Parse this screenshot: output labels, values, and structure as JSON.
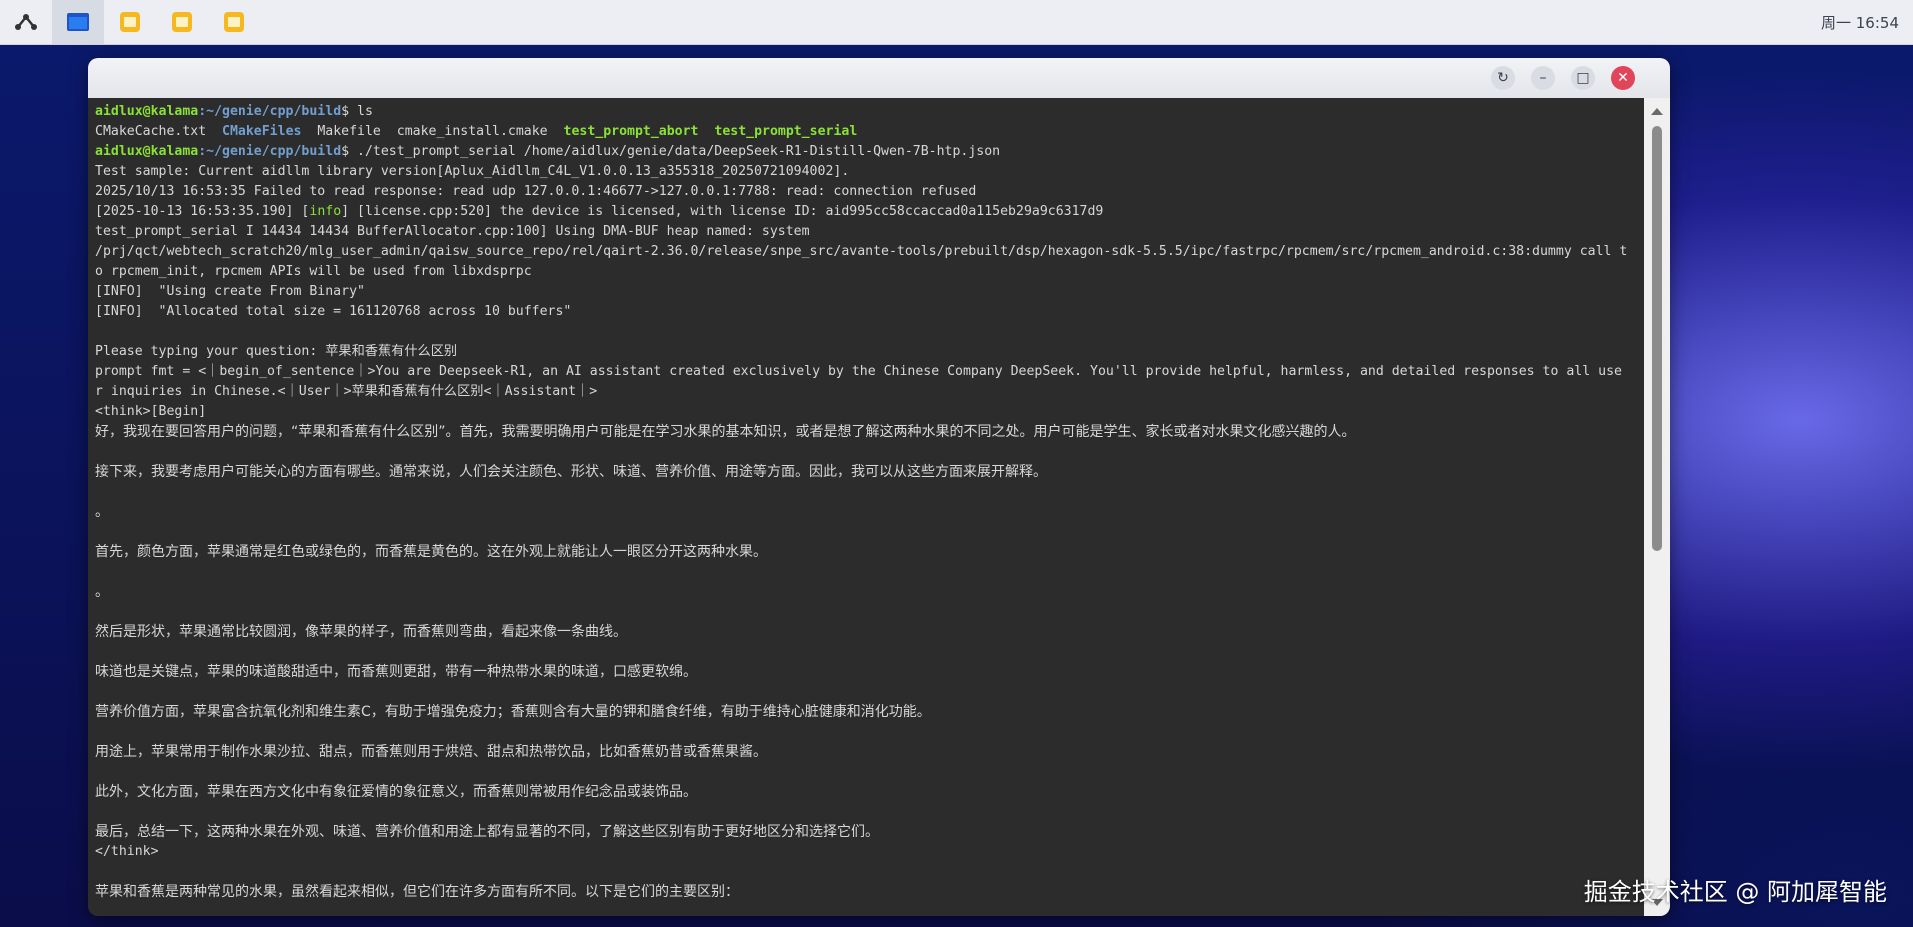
{
  "taskbar": {
    "clock": "周一 16:54",
    "icons": [
      "launcher-icon",
      "terminal-app-icon",
      "folder-icon",
      "folder-icon",
      "folder-icon"
    ]
  },
  "window": {
    "controls": [
      "refresh-icon",
      "minimize-icon",
      "maximize-icon",
      "close-icon"
    ]
  },
  "terminal": {
    "prompt_user": "aidlux@kalama",
    "prompt_path": ":~/genie/cpp/build",
    "lines": [
      {
        "kind": "prompt",
        "cmd": "$ ls"
      },
      {
        "kind": "ls",
        "items": [
          {
            "text": "CMakeCache.txt",
            "cls": "plain"
          },
          {
            "text": "CMakeFiles",
            "cls": "dir"
          },
          {
            "text": "Makefile",
            "cls": "plain"
          },
          {
            "text": "cmake_install.cmake",
            "cls": "plain"
          },
          {
            "text": "test_prompt_abort",
            "cls": "exec"
          },
          {
            "text": "test_prompt_serial",
            "cls": "exec"
          }
        ]
      },
      {
        "kind": "prompt",
        "cmd": "$ ./test_prompt_serial /home/aidlux/genie/data/DeepSeek-R1-Distill-Qwen-7B-htp.json"
      },
      {
        "kind": "text",
        "text": "Test sample: Current aidllm library version[Aplux_Aidllm_C4L_V1.0.0.13_a355318_20250721094002]."
      },
      {
        "kind": "text",
        "text": "2025/10/13 16:53:35 Failed to read response: read udp 127.0.0.1:46677->127.0.0.1:7788: read: connection refused"
      },
      {
        "kind": "info",
        "pre": "[2025-10-13 16:53:35.190] [",
        "tag": "info",
        "post": "] [license.cpp:520] the device is licensed, with license ID: aid995cc58ccaccad0a115eb29a9c6317d9"
      },
      {
        "kind": "text",
        "text": "test_prompt_serial I 14434 14434 BufferAllocator.cpp:100] Using DMA-BUF heap named: system"
      },
      {
        "kind": "text",
        "text": "/prj/qct/webtech_scratch20/mlg_user_admin/qaisw_source_repo/rel/qairt-2.36.0/release/snpe_src/avante-tools/prebuilt/dsp/hexagon-sdk-5.5.5/ipc/fastrpc/rpcmem/src/rpcmem_android.c:38:dummy call t"
      },
      {
        "kind": "text",
        "text": "o rpcmem_init, rpcmem APIs will be used from libxdsprpc"
      },
      {
        "kind": "text",
        "text": "[INFO]  \"Using create From Binary\""
      },
      {
        "kind": "text",
        "text": "[INFO]  \"Allocated total size = 161120768 across 10 buffers\""
      },
      {
        "kind": "text",
        "text": ""
      },
      {
        "kind": "text",
        "text": "Please typing your question: 苹果和香蕉有什么区别"
      },
      {
        "kind": "text",
        "text": "prompt fmt = <｜begin_of_sentence｜>You are Deepseek-R1, an AI assistant created exclusively by the Chinese Company DeepSeek. You'll provide helpful, harmless, and detailed responses to all use"
      },
      {
        "kind": "text",
        "text": "r inquiries in Chinese.<｜User｜>苹果和香蕉有什么区别<｜Assistant｜>"
      },
      {
        "kind": "text",
        "text": "<think>[Begin]"
      },
      {
        "kind": "zh",
        "text": "好，我现在要回答用户的问题，“苹果和香蕉有什么区别”。首先，我需要明确用户可能是在学习水果的基本知识，或者是想了解这两种水果的不同之处。用户可能是学生、家长或者对水果文化感兴趣的人。"
      },
      {
        "kind": "zh",
        "text": ""
      },
      {
        "kind": "zh",
        "text": "接下来，我要考虑用户可能关心的方面有哪些。通常来说，人们会关注颜色、形状、味道、营养价值、用途等方面。因此，我可以从这些方面来展开解释。"
      },
      {
        "kind": "zh",
        "text": ""
      },
      {
        "kind": "zh",
        "text": "。"
      },
      {
        "kind": "zh",
        "text": ""
      },
      {
        "kind": "zh",
        "text": "首先，颜色方面，苹果通常是红色或绿色的，而香蕉是黄色的。这在外观上就能让人一眼区分开这两种水果。"
      },
      {
        "kind": "zh",
        "text": ""
      },
      {
        "kind": "zh",
        "text": "。"
      },
      {
        "kind": "zh",
        "text": ""
      },
      {
        "kind": "zh",
        "text": "然后是形状，苹果通常比较圆润，像苹果的样子，而香蕉则弯曲，看起来像一条曲线。"
      },
      {
        "kind": "zh",
        "text": ""
      },
      {
        "kind": "zh",
        "text": "味道也是关键点，苹果的味道酸甜适中，而香蕉则更甜，带有一种热带水果的味道，口感更软绵。"
      },
      {
        "kind": "zh",
        "text": ""
      },
      {
        "kind": "zh",
        "text": "营养价值方面，苹果富含抗氧化剂和维生素C，有助于增强免疫力；香蕉则含有大量的钾和膳食纤维，有助于维持心脏健康和消化功能。"
      },
      {
        "kind": "zh",
        "text": ""
      },
      {
        "kind": "zh",
        "text": "用途上，苹果常用于制作水果沙拉、甜点，而香蕉则用于烘焙、甜点和热带饮品，比如香蕉奶昔或香蕉果酱。"
      },
      {
        "kind": "zh",
        "text": ""
      },
      {
        "kind": "zh",
        "text": "此外，文化方面，苹果在西方文化中有象征爱情的象征意义，而香蕉则常被用作纪念品或装饰品。"
      },
      {
        "kind": "zh",
        "text": ""
      },
      {
        "kind": "zh",
        "text": "最后，总结一下，这两种水果在外观、味道、营养价值和用途上都有显著的不同，了解这些区别有助于更好地区分和选择它们。"
      },
      {
        "kind": "text",
        "text": "</think>"
      },
      {
        "kind": "zh",
        "text": ""
      },
      {
        "kind": "zh",
        "text": "苹果和香蕉是两种常见的水果，虽然看起来相似，但它们在许多方面有所不同。以下是它们的主要区别："
      }
    ]
  },
  "watermark": "掘金技术社区 @ 阿加犀智能"
}
